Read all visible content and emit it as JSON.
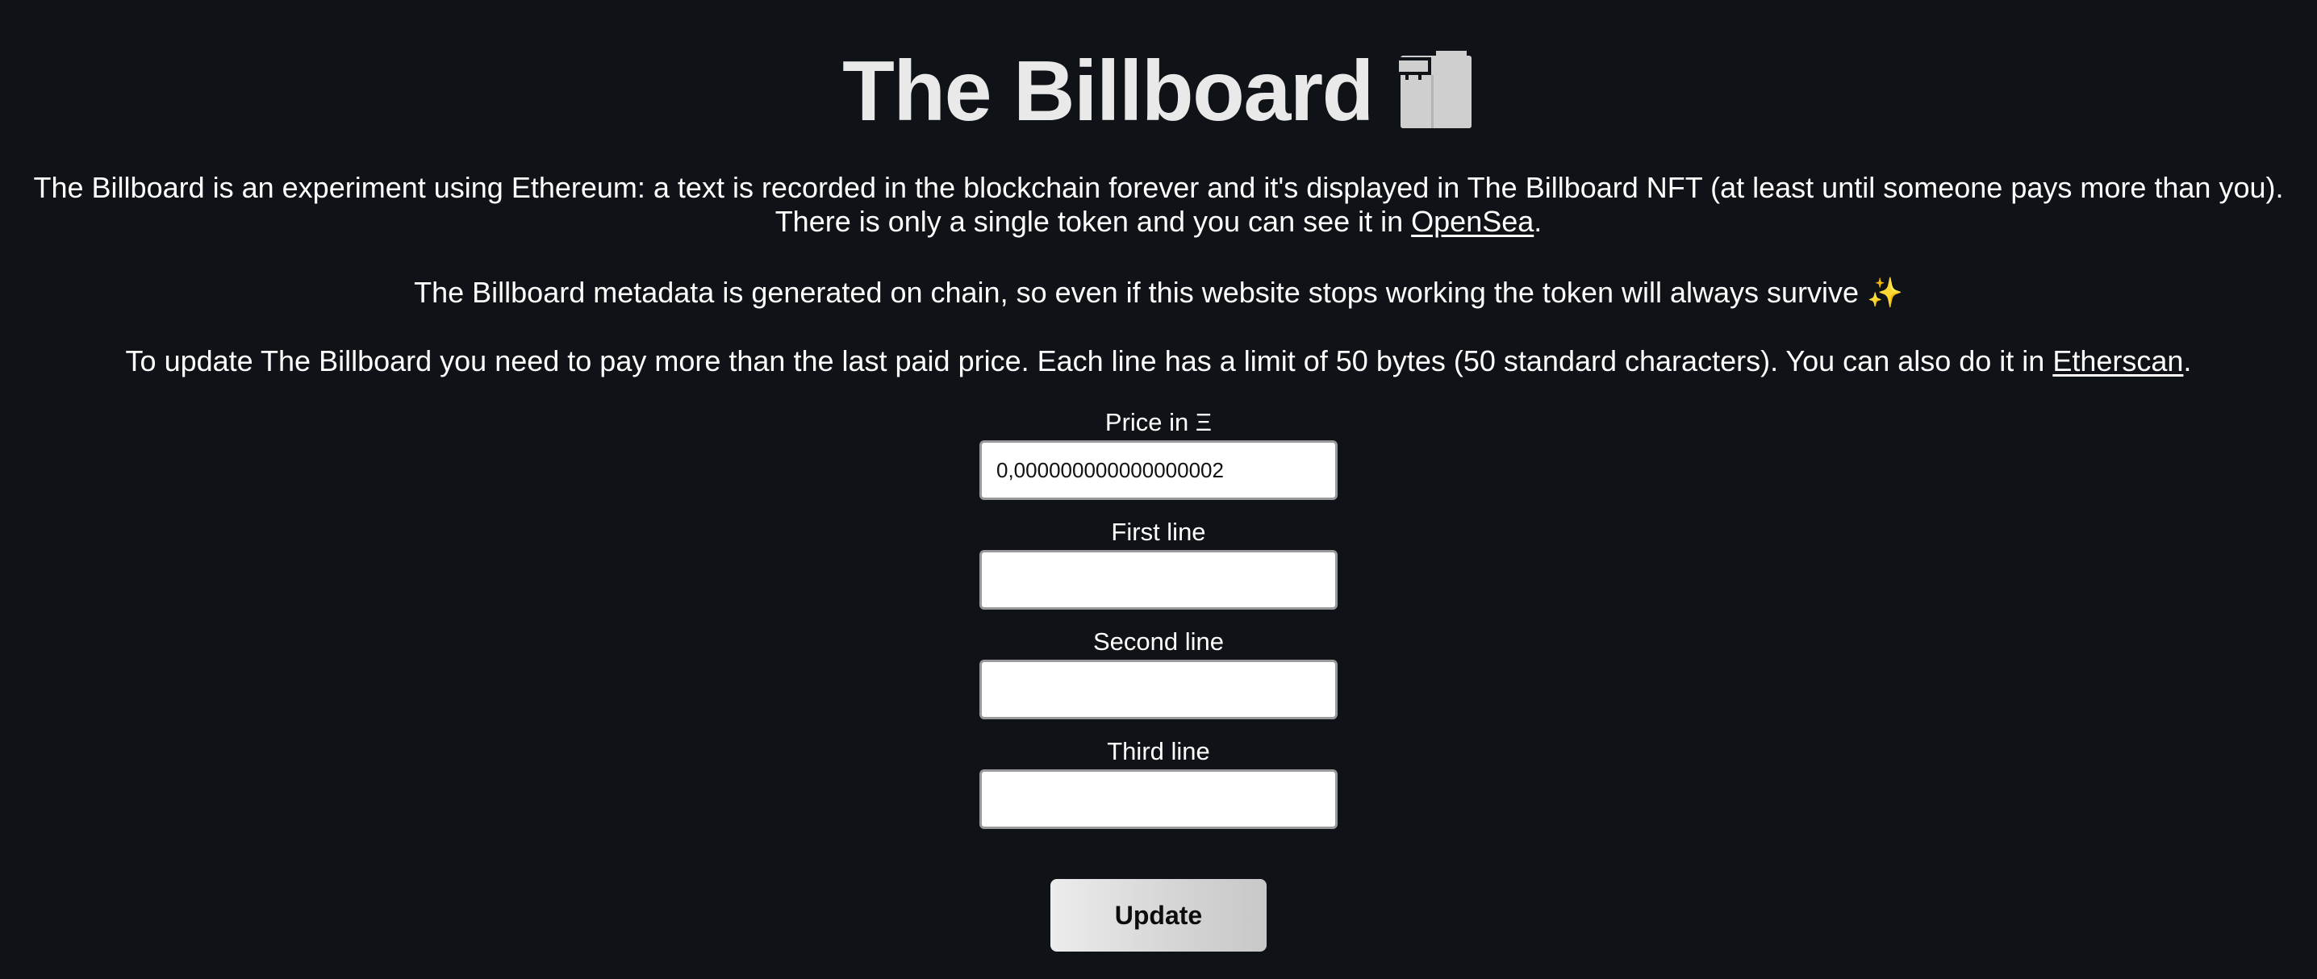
{
  "header": {
    "title": "The Billboard",
    "logo_icon": "billboard-icon"
  },
  "intro": {
    "line1": "The Billboard is an experiment using Ethereum: a text is recorded in the blockchain forever and it's displayed in The Billboard NFT (at least until someone pays more than you).",
    "line2_before": "There is only a single token and you can see it in ",
    "line2_link": "OpenSea",
    "line2_after": "."
  },
  "metadata": {
    "text": "The Billboard metadata is generated on chain, so even if this website stops working the token will always survive",
    "emoji": "✨"
  },
  "update_info": {
    "text_before": "To update The Billboard you need to pay more than the last paid price. Each line has a limit of 50 bytes (50 standard characters). You can also do it in ",
    "link": "Etherscan",
    "text_after": "."
  },
  "form": {
    "price": {
      "label": "Price in Ξ",
      "value": "0,000000000000000002"
    },
    "first_line": {
      "label": "First line",
      "value": ""
    },
    "second_line": {
      "label": "Second line",
      "value": ""
    },
    "third_line": {
      "label": "Third line",
      "value": ""
    },
    "submit_label": "Update"
  },
  "colors": {
    "background": "#0f1216",
    "text": "#ffffff",
    "title": "#e9e9e9",
    "logo": "#cfcfcf"
  }
}
